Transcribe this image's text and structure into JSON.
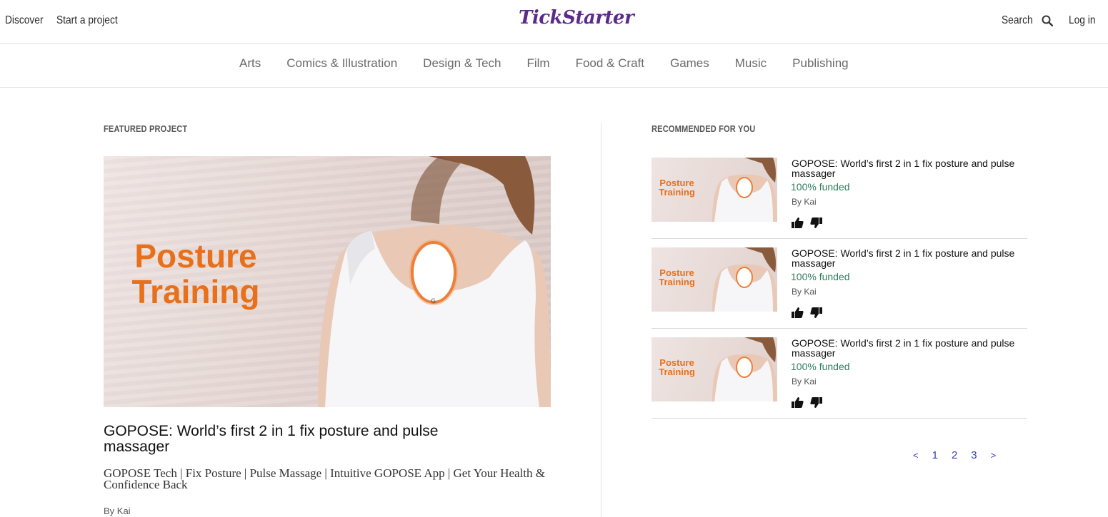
{
  "nav": {
    "discover": "Discover",
    "start_project": "Start a project",
    "logo": "TickStarter",
    "search": "Search",
    "login": "Log in"
  },
  "categories": [
    "Arts",
    "Comics & Illustration",
    "Design & Tech",
    "Film",
    "Food & Craft",
    "Games",
    "Music",
    "Publishing"
  ],
  "featured": {
    "section_label": "FEATURED PROJECT",
    "image_text_line1": "Posture",
    "image_text_line2": "Training",
    "title": "GOPOSE: World’s first 2 in 1 fix posture and pulse massager",
    "description": "GOPOSE Tech | Fix Posture | Pulse Massage | Intuitive GOPOSE App | Get Your Health & Confidence Back",
    "by": "By Kai"
  },
  "recommended": {
    "section_label": "RECOMMENDED FOR YOU",
    "items": [
      {
        "title": "GOPOSE: World’s first 2 in 1 fix posture and pulse massager",
        "funded": "100% funded",
        "by": "By Kai",
        "thumb_line1": "Posture",
        "thumb_line2": "Training"
      },
      {
        "title": "GOPOSE: World’s first 2 in 1 fix posture and pulse massager",
        "funded": "100% funded",
        "by": "By Kai",
        "thumb_line1": "Posture",
        "thumb_line2": "Training"
      },
      {
        "title": "GOPOSE: World’s first 2 in 1 fix posture and pulse massager",
        "funded": "100% funded",
        "by": "By Kai",
        "thumb_line1": "Posture",
        "thumb_line2": "Training"
      }
    ]
  },
  "pagination": {
    "prev": "<",
    "pages": [
      "1",
      "2",
      "3"
    ],
    "next": ">"
  },
  "colors": {
    "brand": "#5b2a8a",
    "accent_orange": "#e8701a",
    "funded_green": "#2e7d5b",
    "pager_blue": "#3a3ac0"
  },
  "icons": {
    "search": "search-icon",
    "thumbs_up": "thumbs-up-icon",
    "thumbs_down": "thumbs-down-icon"
  }
}
